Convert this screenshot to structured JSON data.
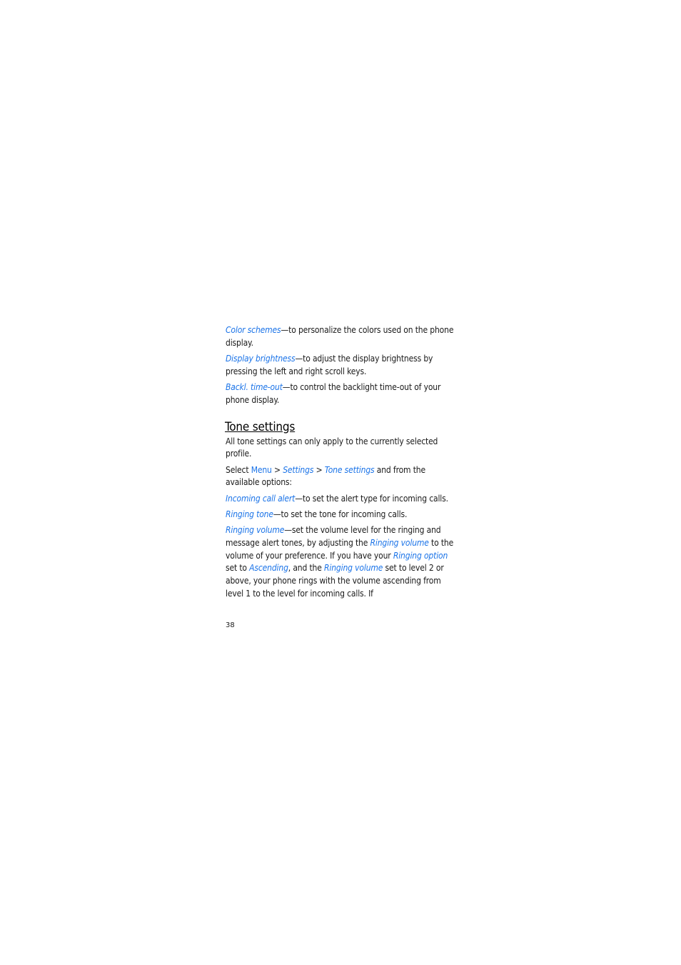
{
  "display_items": [
    {
      "term": "Color schemes",
      "desc": "—to personalize the colors used on the phone display."
    },
    {
      "term": "Display brightness",
      "desc": "—to adjust the display brightness by pressing the left and right scroll keys."
    },
    {
      "term": "Backl. time-out",
      "desc": "—to control the backlight time-out of your phone display."
    }
  ],
  "section": {
    "title": "Tone settings",
    "intro": "All tone settings can only apply to the currently selected profile.",
    "path": {
      "prefix": "Select ",
      "menu": "Menu",
      "sep1": " > ",
      "settings": "Settings",
      "sep2": " > ",
      "tone_settings": "Tone settings",
      "suffix": " and from the available options:"
    },
    "options": [
      {
        "term": "Incoming call alert",
        "desc": "—to set the alert type for incoming calls."
      },
      {
        "term": "Ringing tone",
        "desc": "—to set the tone for incoming calls."
      }
    ],
    "ringing_volume": {
      "term": "Ringing volume",
      "t1": "—set the volume level for the ringing and message alert tones, by adjusting the ",
      "l1": "Ringing volume",
      "t2": " to the volume of your preference. If you have your ",
      "l2": "Ringing option",
      "t3": " set to ",
      "l3": "Ascending",
      "t4": ", and the ",
      "l4": "Ringing volume",
      "t5": " set to level 2 or above, your phone rings with the volume ascending from level 1 to the level for incoming calls. If"
    }
  },
  "page_number": "38"
}
